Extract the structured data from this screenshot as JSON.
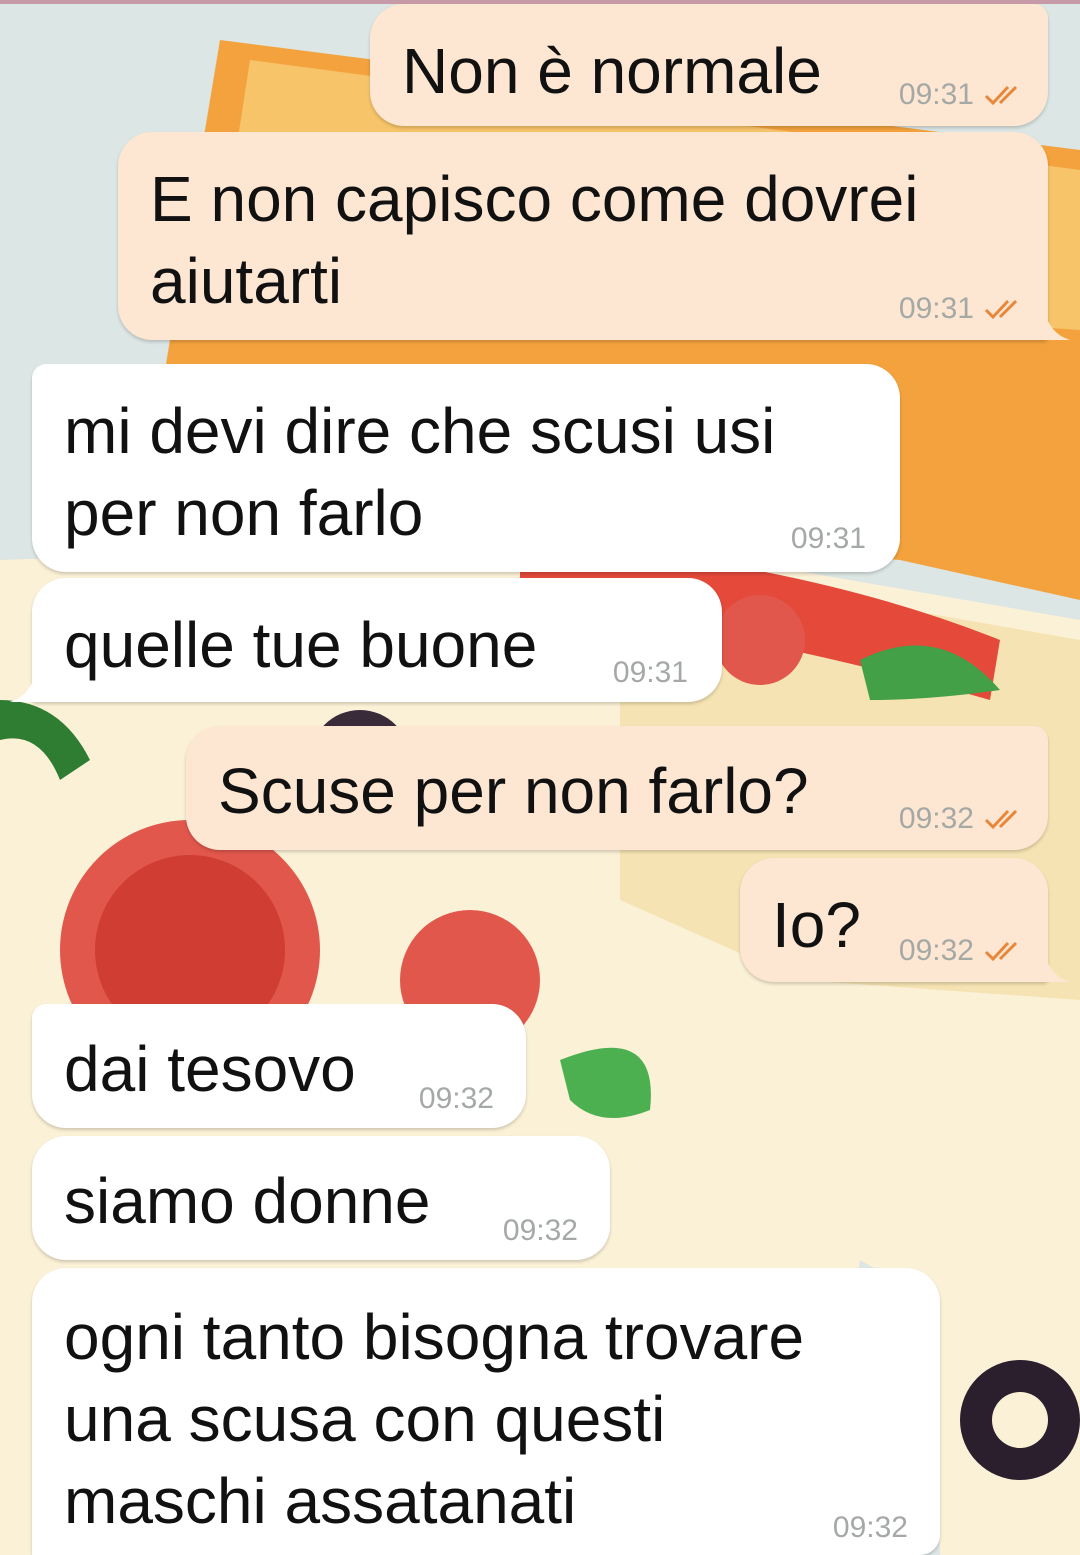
{
  "colors": {
    "outgoing_bubble": "#fde6d2",
    "incoming_bubble": "#ffffff",
    "read_ticks": "#e8873a",
    "timestamp": "#a5a9a6"
  },
  "messages": [
    {
      "direction": "outgoing",
      "lines": [
        "Non è normale"
      ],
      "time": "09:31",
      "status_icon": "double-check-icon"
    },
    {
      "direction": "outgoing",
      "lines": [
        "E non capisco come dovrei",
        "aiutarti"
      ],
      "time": "09:31",
      "status_icon": "double-check-icon"
    },
    {
      "direction": "incoming",
      "lines": [
        "mi devi dire che scusi usi",
        "per non farlo"
      ],
      "time": "09:31"
    },
    {
      "direction": "incoming",
      "lines": [
        "quelle tue buone"
      ],
      "time": "09:31"
    },
    {
      "direction": "outgoing",
      "lines": [
        "Scuse per non farlo?"
      ],
      "time": "09:32",
      "status_icon": "double-check-icon"
    },
    {
      "direction": "outgoing",
      "lines": [
        "Io?"
      ],
      "time": "09:32",
      "status_icon": "double-check-icon"
    },
    {
      "direction": "incoming",
      "lines": [
        "dai tesovo"
      ],
      "time": "09:32"
    },
    {
      "direction": "incoming",
      "lines": [
        "siamo donne"
      ],
      "time": "09:32"
    },
    {
      "direction": "incoming",
      "lines": [
        "ogni tanto bisogna trovare",
        "una scusa con questi",
        "maschi assatanati"
      ],
      "time": "09:32"
    }
  ]
}
